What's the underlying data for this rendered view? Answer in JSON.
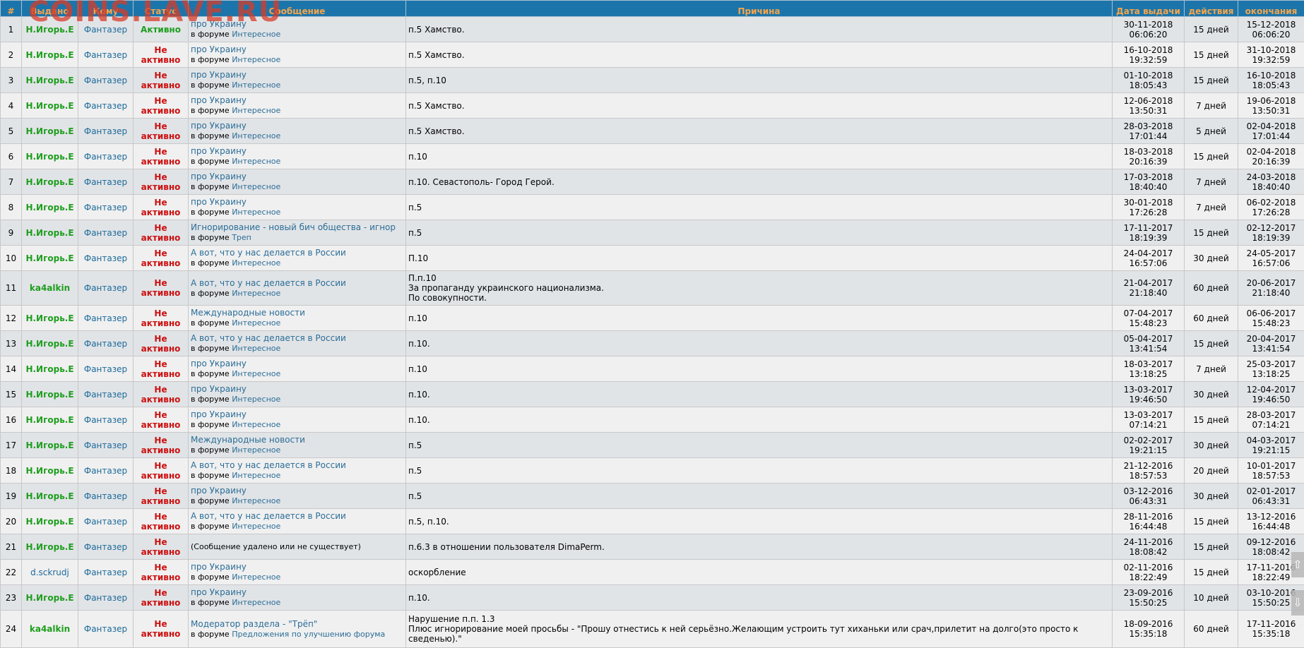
{
  "watermark": "COINS.LAVE.RU",
  "headers": {
    "num": "#",
    "issuer": "Выдано",
    "to": "Кому",
    "status": "Статус",
    "message": "Сообщение",
    "reason": "Причина",
    "date": "Дата выдачи",
    "duration": "действия",
    "end": "окончания"
  },
  "in_forum_prefix": "в форуме",
  "rows": [
    {
      "num": "1",
      "issuer": "Н.Игорь.Е",
      "to": "Фантазер",
      "status": "Активно",
      "active": true,
      "topic": "про Украину",
      "forum": "Интересное",
      "reason": "п.5 Хамство.",
      "date": "30-11-2018",
      "time": "06:06:20",
      "dur": "15 дней",
      "end_date": "15-12-2018",
      "end_time": "06:06:20"
    },
    {
      "num": "2",
      "issuer": "Н.Игорь.Е",
      "to": "Фантазер",
      "status": "Не активно",
      "topic": "про Украину",
      "forum": "Интересное",
      "reason": "п.5 Хамство.",
      "date": "16-10-2018",
      "time": "19:32:59",
      "dur": "15 дней",
      "end_date": "31-10-2018",
      "end_time": "19:32:59"
    },
    {
      "num": "3",
      "issuer": "Н.Игорь.Е",
      "to": "Фантазер",
      "status": "Не активно",
      "topic": "про Украину",
      "forum": "Интересное",
      "reason": "п.5, п.10",
      "date": "01-10-2018",
      "time": "18:05:43",
      "dur": "15 дней",
      "end_date": "16-10-2018",
      "end_time": "18:05:43"
    },
    {
      "num": "4",
      "issuer": "Н.Игорь.Е",
      "to": "Фантазер",
      "status": "Не активно",
      "topic": "про Украину",
      "forum": "Интересное",
      "reason": "п.5 Хамство.",
      "date": "12-06-2018",
      "time": "13:50:31",
      "dur": "7 дней",
      "end_date": "19-06-2018",
      "end_time": "13:50:31"
    },
    {
      "num": "5",
      "issuer": "Н.Игорь.Е",
      "to": "Фантазер",
      "status": "Не активно",
      "topic": "про Украину",
      "forum": "Интересное",
      "reason": "п.5 Хамство.",
      "date": "28-03-2018",
      "time": "17:01:44",
      "dur": "5 дней",
      "end_date": "02-04-2018",
      "end_time": "17:01:44"
    },
    {
      "num": "6",
      "issuer": "Н.Игорь.Е",
      "to": "Фантазер",
      "status": "Не активно",
      "topic": "про Украину",
      "forum": "Интересное",
      "reason": "п.10",
      "date": "18-03-2018",
      "time": "20:16:39",
      "dur": "15 дней",
      "end_date": "02-04-2018",
      "end_time": "20:16:39"
    },
    {
      "num": "7",
      "issuer": "Н.Игорь.Е",
      "to": "Фантазер",
      "status": "Не активно",
      "topic": "про Украину",
      "forum": "Интересное",
      "reason": "п.10. Севастополь- Город Герой.",
      "date": "17-03-2018",
      "time": "18:40:40",
      "dur": "7 дней",
      "end_date": "24-03-2018",
      "end_time": "18:40:40"
    },
    {
      "num": "8",
      "issuer": "Н.Игорь.Е",
      "to": "Фантазер",
      "status": "Не активно",
      "topic": "про Украину",
      "forum": "Интересное",
      "reason": "п.5",
      "date": "30-01-2018",
      "time": "17:26:28",
      "dur": "7 дней",
      "end_date": "06-02-2018",
      "end_time": "17:26:28"
    },
    {
      "num": "9",
      "issuer": "Н.Игорь.Е",
      "to": "Фантазер",
      "status": "Не активно",
      "topic": "Игнорирование - новый бич общества - игнор",
      "forum": "Треп",
      "reason": "п.5",
      "date": "17-11-2017",
      "time": "18:19:39",
      "dur": "15 дней",
      "end_date": "02-12-2017",
      "end_time": "18:19:39"
    },
    {
      "num": "10",
      "issuer": "Н.Игорь.Е",
      "to": "Фантазер",
      "status": "Не активно",
      "topic": "А вот, что у нас делается в России",
      "forum": "Интересное",
      "reason": "П.10",
      "date": "24-04-2017",
      "time": "16:57:06",
      "dur": "30 дней",
      "end_date": "24-05-2017",
      "end_time": "16:57:06"
    },
    {
      "num": "11",
      "issuer": "ka4alkin",
      "to": "Фантазер",
      "status": "Не активно",
      "topic": "А вот, что у нас делается в России",
      "forum": "Интересное",
      "reason_lines": [
        "П.п.10",
        "За пропаганду украинского национализма.",
        "По совокупности."
      ],
      "date": "21-04-2017",
      "time": "21:18:40",
      "dur": "60 дней",
      "end_date": "20-06-2017",
      "end_time": "21:18:40"
    },
    {
      "num": "12",
      "issuer": "Н.Игорь.Е",
      "to": "Фантазер",
      "status": "Не активно",
      "topic": "Международные новости",
      "forum": "Интересное",
      "reason": "п.10",
      "date": "07-04-2017",
      "time": "15:48:23",
      "dur": "60 дней",
      "end_date": "06-06-2017",
      "end_time": "15:48:23"
    },
    {
      "num": "13",
      "issuer": "Н.Игорь.Е",
      "to": "Фантазер",
      "status": "Не активно",
      "topic": "А вот, что у нас делается в России",
      "forum": "Интересное",
      "reason": "п.10.",
      "date": "05-04-2017",
      "time": "13:41:54",
      "dur": "15 дней",
      "end_date": "20-04-2017",
      "end_time": "13:41:54"
    },
    {
      "num": "14",
      "issuer": "Н.Игорь.Е",
      "to": "Фантазер",
      "status": "Не активно",
      "topic": "про Украину",
      "forum": "Интересное",
      "reason": "п.10",
      "date": "18-03-2017",
      "time": "13:18:25",
      "dur": "7 дней",
      "end_date": "25-03-2017",
      "end_time": "13:18:25"
    },
    {
      "num": "15",
      "issuer": "Н.Игорь.Е",
      "to": "Фантазер",
      "status": "Не активно",
      "topic": "про Украину",
      "forum": "Интересное",
      "reason": "п.10.",
      "date": "13-03-2017",
      "time": "19:46:50",
      "dur": "30 дней",
      "end_date": "12-04-2017",
      "end_time": "19:46:50"
    },
    {
      "num": "16",
      "issuer": "Н.Игорь.Е",
      "to": "Фантазер",
      "status": "Не активно",
      "topic": "про Украину",
      "forum": "Интересное",
      "reason": "п.10.",
      "date": "13-03-2017",
      "time": "07:14:21",
      "dur": "15 дней",
      "end_date": "28-03-2017",
      "end_time": "07:14:21"
    },
    {
      "num": "17",
      "issuer": "Н.Игорь.Е",
      "to": "Фантазер",
      "status": "Не активно",
      "topic": "Международные новости",
      "forum": "Интересное",
      "reason": "п.5",
      "date": "02-02-2017",
      "time": "19:21:15",
      "dur": "30 дней",
      "end_date": "04-03-2017",
      "end_time": "19:21:15"
    },
    {
      "num": "18",
      "issuer": "Н.Игорь.Е",
      "to": "Фантазер",
      "status": "Не активно",
      "topic": "А вот, что у нас делается в России",
      "forum": "Интересное",
      "reason": "п.5",
      "date": "21-12-2016",
      "time": "18:57:53",
      "dur": "20 дней",
      "end_date": "10-01-2017",
      "end_time": "18:57:53"
    },
    {
      "num": "19",
      "issuer": "Н.Игорь.Е",
      "to": "Фантазер",
      "status": "Не активно",
      "topic": "про Украину",
      "forum": "Интересное",
      "reason": "п.5",
      "date": "03-12-2016",
      "time": "06:43:31",
      "dur": "30 дней",
      "end_date": "02-01-2017",
      "end_time": "06:43:31"
    },
    {
      "num": "20",
      "issuer": "Н.Игорь.Е",
      "to": "Фантазер",
      "status": "Не активно",
      "topic": "А вот, что у нас делается в России",
      "forum": "Интересное",
      "reason": "п.5, п.10.",
      "date": "28-11-2016",
      "time": "16:44:48",
      "dur": "15 дней",
      "end_date": "13-12-2016",
      "end_time": "16:44:48"
    },
    {
      "num": "21",
      "issuer": "Н.Игорь.Е",
      "to": "Фантазер",
      "status": "Не активно",
      "deleted": "(Сообщение удалено или не существует)",
      "reason": "п.6.3 в отношении пользователя DimaPerm.",
      "date": "24-11-2016",
      "time": "18:08:42",
      "dur": "15 дней",
      "end_date": "09-12-2016",
      "end_time": "18:08:42"
    },
    {
      "num": "22",
      "issuer": "d.sckrudj",
      "to": "Фантазер",
      "status": "Не активно",
      "topic": "про Украину",
      "forum": "Интересное",
      "reason": "оскорбление",
      "date": "02-11-2016",
      "time": "18:22:49",
      "dur": "15 дней",
      "end_date": "17-11-2016",
      "end_time": "18:22:49"
    },
    {
      "num": "23",
      "issuer": "Н.Игорь.Е",
      "to": "Фантазер",
      "status": "Не активно",
      "topic": "про Украину",
      "forum": "Интересное",
      "reason": "п.10.",
      "date": "23-09-2016",
      "time": "15:50:25",
      "dur": "10 дней",
      "end_date": "03-10-2016",
      "end_time": "15:50:25"
    },
    {
      "num": "24",
      "issuer": "ka4alkin",
      "to": "Фантазер",
      "status": "Не активно",
      "topic": "Модератор раздела - \"Трёп\"",
      "forum": "Предложения по улучшению форума",
      "reason_lines": [
        "Нарушение п.п. 1.3",
        "Плюс игнорирование моей просьбы - \"Прошу отнестись к ней серьёзно.Желающим устроить тут хиханьки или срач,прилетит на долго(это просто к",
        "сведенью).\""
      ],
      "date": "18-09-2016",
      "time": "15:35:18",
      "dur": "60 дней",
      "end_date": "17-11-2016",
      "end_time": "15:35:18"
    }
  ]
}
